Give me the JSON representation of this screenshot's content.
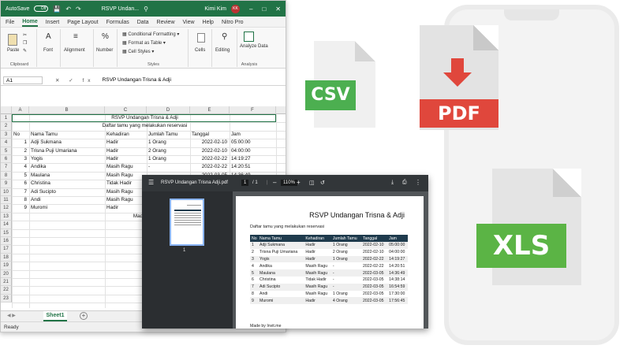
{
  "excel": {
    "autosave_label": "AutoSave",
    "autosave_state": "Off",
    "doc_title": "RSVP Undan...",
    "user_name": "Kimi Kim",
    "user_initials": "KK",
    "menu": [
      "File",
      "Home",
      "Insert",
      "Page Layout",
      "Formulas",
      "Data",
      "Review",
      "View",
      "Help",
      "Nitro Pro"
    ],
    "active_menu": "Home",
    "ribbon": {
      "clipboard": "Clipboard",
      "paste": "Paste",
      "font": "Font",
      "alignment": "Alignment",
      "number": "Number",
      "conditional": "Conditional Formatting",
      "format_table": "Format as Table",
      "cell_styles": "Cell Styles",
      "styles": "Styles",
      "cells": "Cells",
      "editing": "Editing",
      "analyze": "Analyze Data",
      "analysis": "Analysis"
    },
    "name_box": "A1",
    "fx_symbols": "✕ ✓ fx",
    "formula": "RSVP Undangan Trisna & Adji",
    "columns": [
      "A",
      "B",
      "C",
      "D",
      "E",
      "F"
    ],
    "rows": [
      "1",
      "2",
      "3",
      "4",
      "5",
      "6",
      "7",
      "8",
      "9",
      "10",
      "11",
      "12",
      "13",
      "14",
      "15",
      "16",
      "17",
      "18",
      "19",
      "20",
      "21",
      "22",
      "23"
    ],
    "title": "RSVP Undangan Trisna & Adji",
    "subtitle": "Daftar tamu yang melakukan reservasi",
    "headers": [
      "No",
      "Nama Tamu",
      "Kehadiran",
      "Jumlah Tamu",
      "Tanggal",
      "Jam"
    ],
    "data": [
      [
        "1",
        "Adji Sukmana",
        "Hadir",
        "1 Orang",
        "2022-02-10",
        "05:00:00"
      ],
      [
        "2",
        "Trisna Puji Umariana",
        "Hadir",
        "2 Orang",
        "2022-02-10",
        "04:00:00"
      ],
      [
        "3",
        "Yogis",
        "Hadir",
        "1 Orang",
        "2022-02-22",
        "14:19:27"
      ],
      [
        "4",
        "Andika",
        "Masih Ragu",
        "-",
        "2022-02-22",
        "14:20:51"
      ],
      [
        "5",
        "Maulana",
        "Masih Ragu",
        "-",
        "2022-03-05",
        "14:36:49"
      ],
      [
        "6",
        "Christina",
        "Tidak Hadir",
        "-",
        "2022-03-05",
        "14:38:14"
      ],
      [
        "7",
        "Adi Sucipto",
        "Masih Ragu",
        "-",
        "2022-03-05",
        "16:54:59"
      ],
      [
        "8",
        "Andi",
        "Masih Ragu",
        "1 Orang",
        "2022-03-05",
        "17:30:00"
      ],
      [
        "9",
        "Muromi",
        "Hadir",
        "4 Orang",
        "2022-03-05",
        "17:56:45"
      ]
    ],
    "made_by": "Made by",
    "sheet_name": "Sheet1",
    "add_sheet": "+",
    "status": "Ready"
  },
  "pdf": {
    "filename": "RSVP Undangan Trisna Adji.pdf",
    "page_current": "1",
    "page_total": "/ 1",
    "zoom": "110%",
    "thumb_number": "1",
    "title": "RSVP Undangan Trisna & Adji",
    "subtitle": "Daftar tamu yang melakukan reservasi",
    "headers": [
      "No",
      "Nama Tamu",
      "Kehadiran",
      "Jumlah Tamu",
      "Tanggal",
      "Jam"
    ],
    "footer": "Made by Invit.me"
  },
  "icons": {
    "csv": "CSV",
    "pdf": "PDF",
    "xls": "XLS"
  },
  "colors": {
    "excel_green": "#217346",
    "csv_badge": "#4caf50",
    "pdf_badge": "#e0473c",
    "xls_badge": "#5bb445",
    "pdf_header": "#1f3b4d"
  }
}
